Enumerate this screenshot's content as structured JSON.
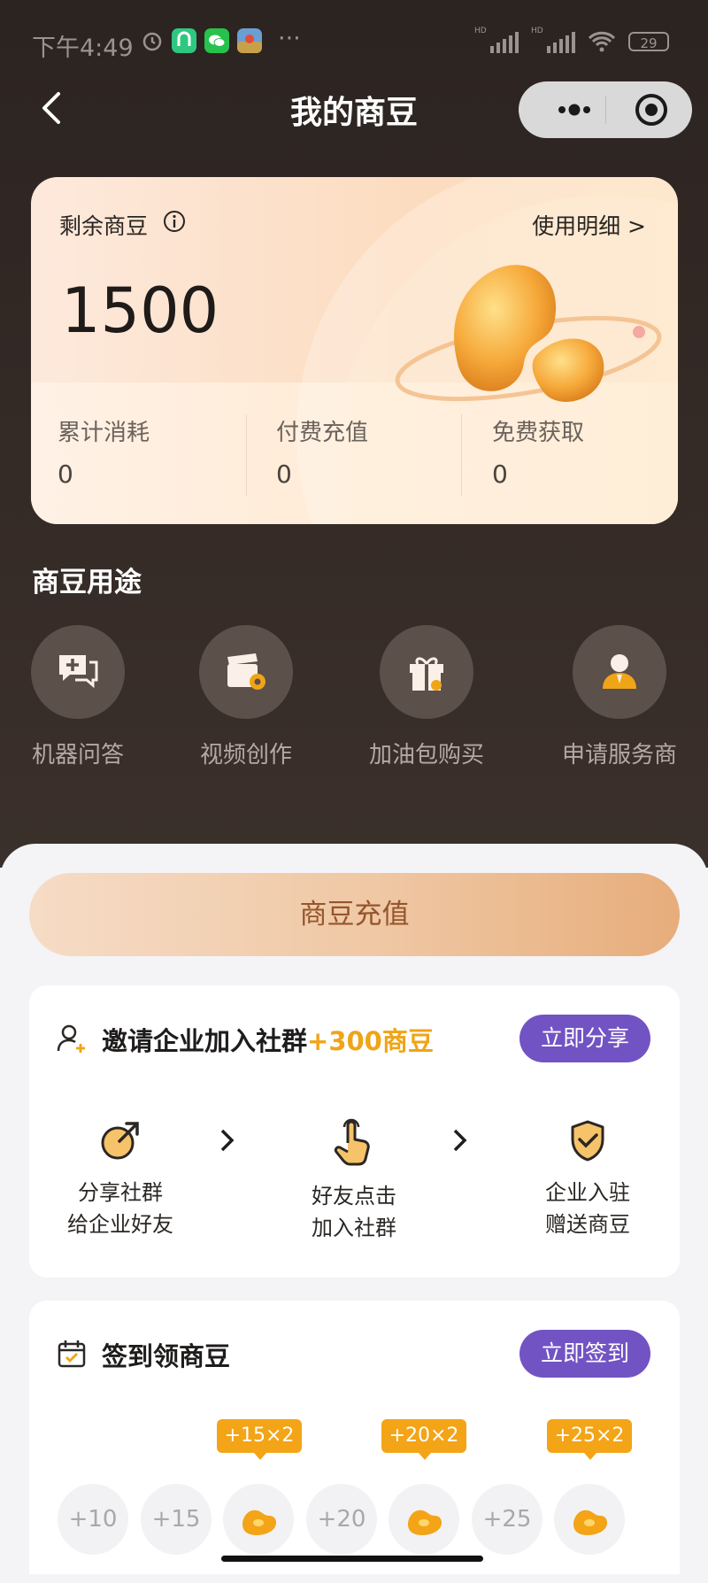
{
  "status_bar": {
    "time": "下午4:49",
    "battery": "29",
    "net_label": "HD"
  },
  "nav": {
    "title": "我的商豆"
  },
  "balance_card": {
    "label": "剩余商豆",
    "detail_link": "使用明细 >",
    "value": "1500",
    "stats": [
      {
        "label": "累计消耗",
        "value": "0"
      },
      {
        "label": "付费充值",
        "value": "0"
      },
      {
        "label": "免费获取",
        "value": "0"
      }
    ]
  },
  "uses": {
    "title": "商豆用途",
    "items": [
      {
        "label": "机器问答",
        "icon": "chat-add-icon"
      },
      {
        "label": "视频创作",
        "icon": "video-settings-icon"
      },
      {
        "label": "加油包购买",
        "icon": "gift-icon"
      },
      {
        "label": "申请服务商",
        "icon": "user-icon"
      }
    ]
  },
  "recharge_button": "商豆充值",
  "invite": {
    "title": "邀请企业加入社群",
    "bonus": "+300商豆",
    "button": "立即分享",
    "steps": [
      {
        "line1": "分享社群",
        "line2": "给企业好友",
        "icon": "share-icon"
      },
      {
        "line1": "好友点击",
        "line2": "加入社群",
        "icon": "hand-tap-icon"
      },
      {
        "line1": "企业入驻",
        "line2": "赠送商豆",
        "icon": "shield-check-icon"
      }
    ]
  },
  "checkin": {
    "title": "签到领商豆",
    "button": "立即签到",
    "badges": [
      "+15×2",
      "+20×2",
      "+25×2"
    ],
    "days": [
      "+10",
      "+15",
      "",
      "+20",
      "",
      "+25",
      ""
    ]
  },
  "colors": {
    "accent": "#7253c3",
    "highlight": "#f0a417",
    "recharge": "#efc7a3"
  }
}
